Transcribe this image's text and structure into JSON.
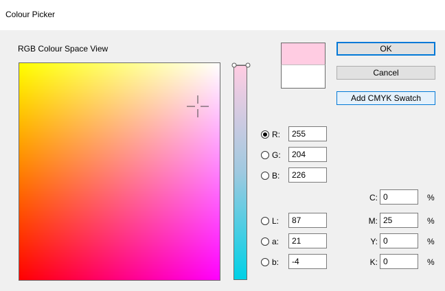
{
  "window": {
    "title": "Colour Picker"
  },
  "view_label": "RGB Colour Space View",
  "colors": {
    "current": "#ffcce2",
    "original": "#ffffff",
    "focus_accent": "#0078d7"
  },
  "buttons": {
    "ok": "OK",
    "cancel": "Cancel",
    "add_cmyk": "Add CMYK Swatch"
  },
  "rgb": [
    {
      "label": "R:",
      "value": "255",
      "selected": true
    },
    {
      "label": "G:",
      "value": "204",
      "selected": false
    },
    {
      "label": "B:",
      "value": "226",
      "selected": false
    }
  ],
  "lab": [
    {
      "label": "L:",
      "value": "87",
      "selected": false
    },
    {
      "label": "a:",
      "value": "21",
      "selected": false
    },
    {
      "label": "b:",
      "value": "-4",
      "selected": false
    }
  ],
  "cmyk": [
    {
      "label": "C:",
      "value": "0",
      "unit": "%"
    },
    {
      "label": "M:",
      "value": "25",
      "unit": "%"
    },
    {
      "label": "Y:",
      "value": "0",
      "unit": "%"
    },
    {
      "label": "K:",
      "value": "0",
      "unit": "%"
    }
  ]
}
